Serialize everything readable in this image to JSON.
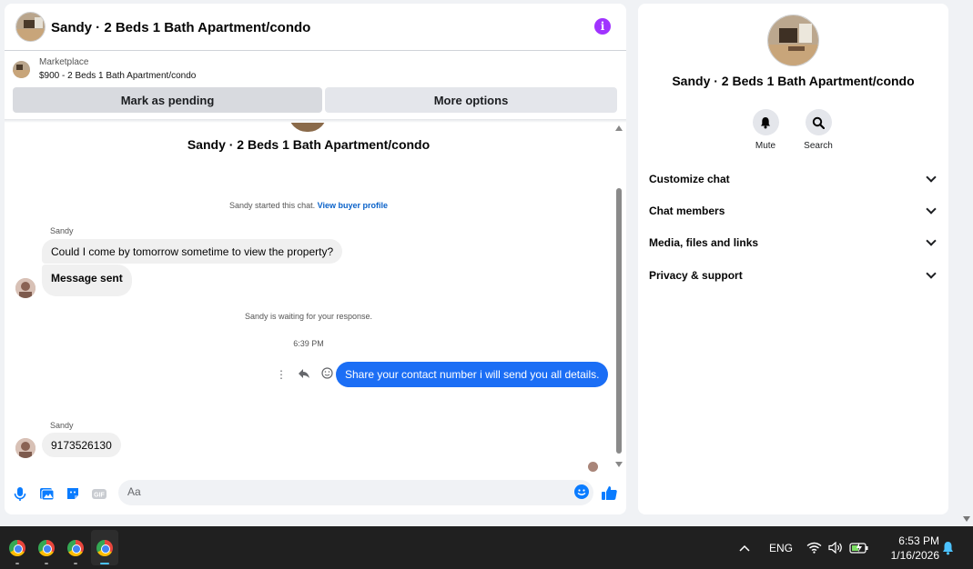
{
  "chat": {
    "header_title": "Sandy · 2 Beds 1 Bath Apartment/condo",
    "marketplace_label": "Marketplace",
    "listing": "$900 - 2 Beds 1 Bath Apartment/condo",
    "mark_pending_label": "Mark as pending",
    "more_options_label": "More options"
  },
  "thread": {
    "title": "Sandy · 2 Beds 1 Bath Apartment/condo",
    "started_text": "Sandy started this chat.",
    "view_buyer_profile": "View buyer profile",
    "waiting_text": "Sandy is waiting for your response.",
    "timestamp": "6:39 PM",
    "messages": [
      {
        "sender": "Sandy",
        "text": "Could I come by tomorrow sometime to view the property?"
      },
      {
        "text": "Message sent"
      },
      {
        "text": "Share your contact number i will send you all details.",
        "outgoing": true
      },
      {
        "sender": "Sandy",
        "text": "9173526130"
      }
    ]
  },
  "composer": {
    "placeholder": "Aa",
    "icons": [
      "microphone-icon",
      "photo-icon",
      "sticker-icon",
      "gif-icon",
      "emoji-icon",
      "like-icon"
    ]
  },
  "info_panel": {
    "title": "Sandy · 2 Beds 1 Bath Apartment/condo",
    "actions": [
      {
        "label": "Mute",
        "icon": "bell-icon"
      },
      {
        "label": "Search",
        "icon": "search-icon"
      }
    ],
    "sections": [
      "Customize chat",
      "Chat members",
      "Media, files and links",
      "Privacy & support"
    ]
  },
  "taskbar": {
    "apps": [
      "chrome",
      "chrome",
      "chrome",
      "chrome"
    ],
    "language": "ENG",
    "time": "6:53 PM",
    "date": "1/16/2026"
  },
  "colors": {
    "accent": "#0a7cff",
    "outgoing_bubble": "#1b6ef5",
    "info_icon": "#a033ff",
    "incoming_bubble": "#f0f0f0"
  }
}
